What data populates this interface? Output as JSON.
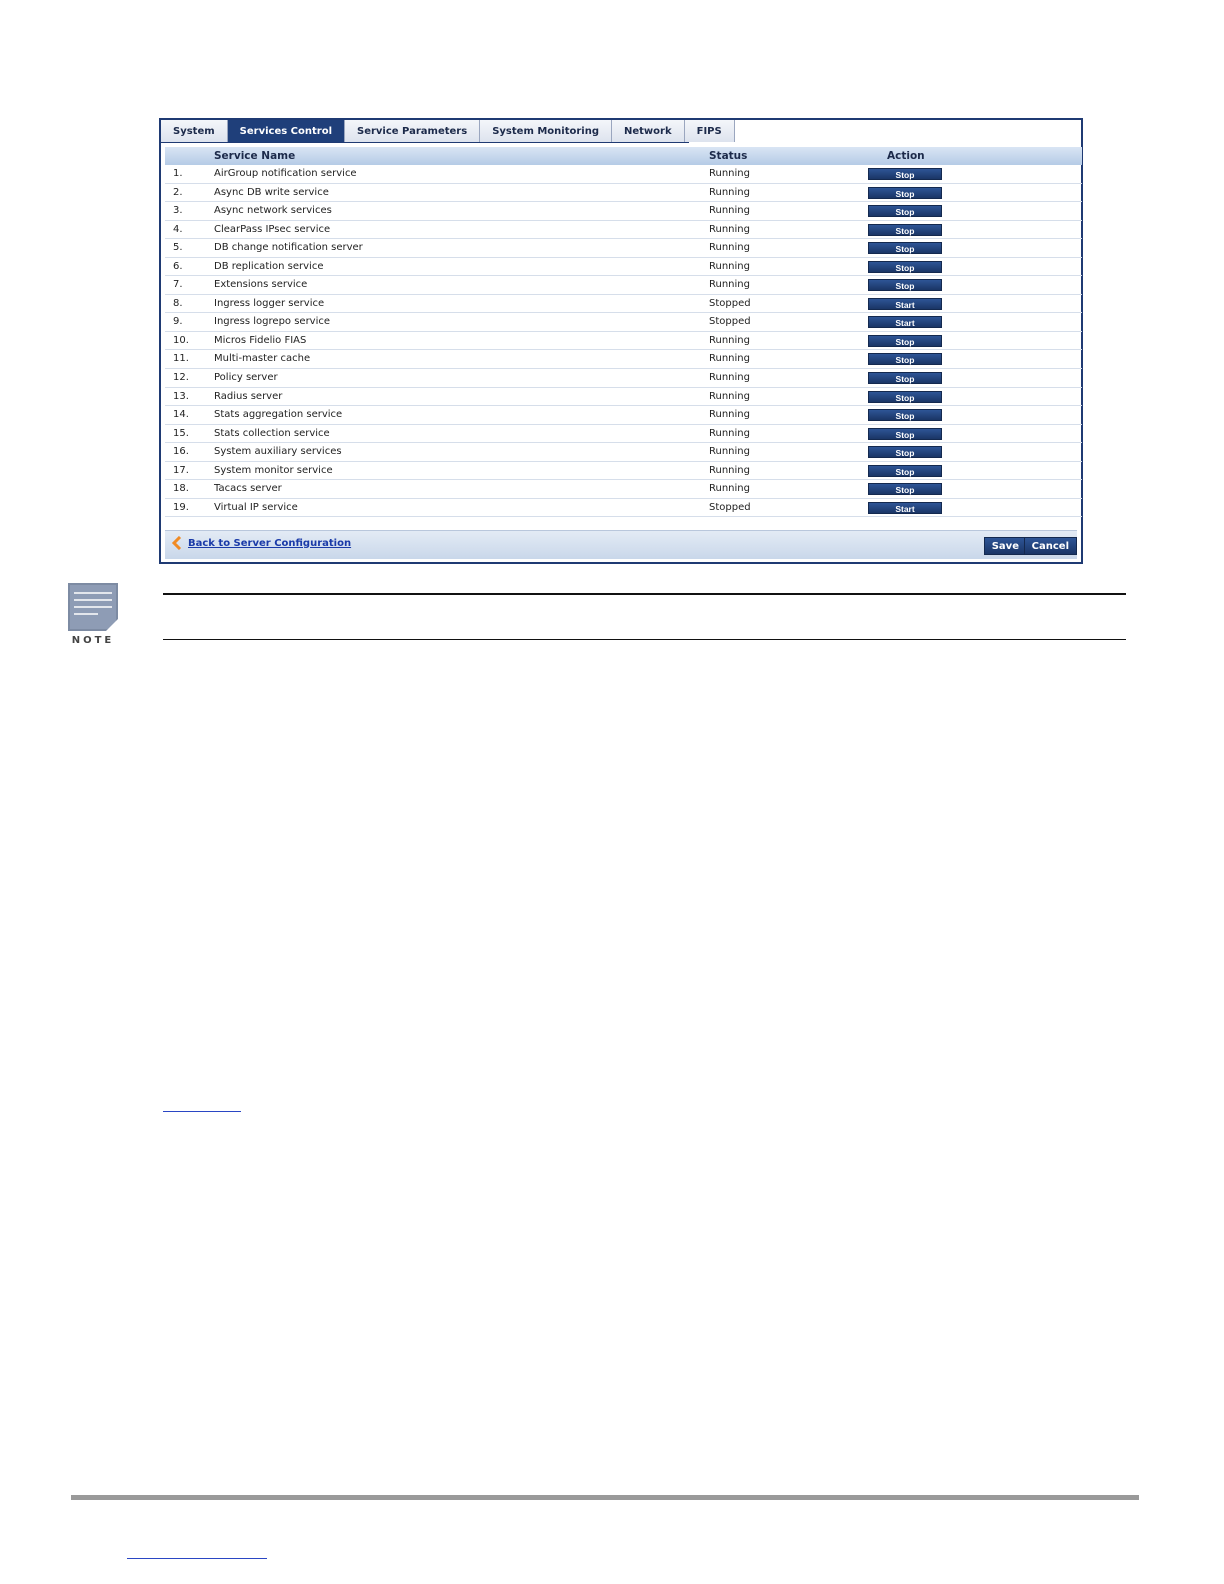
{
  "tabs": [
    "System",
    "Services Control",
    "Service Parameters",
    "System Monitoring",
    "Network",
    "FIPS"
  ],
  "active_tab": 1,
  "table": {
    "headers": {
      "name": "Service Name",
      "status": "Status",
      "action": "Action"
    },
    "rows": [
      {
        "num": "1.",
        "name": "AirGroup notification service",
        "status": "Running",
        "action": "Stop"
      },
      {
        "num": "2.",
        "name": "Async DB write service",
        "status": "Running",
        "action": "Stop"
      },
      {
        "num": "3.",
        "name": "Async network services",
        "status": "Running",
        "action": "Stop"
      },
      {
        "num": "4.",
        "name": "ClearPass IPsec service",
        "status": "Running",
        "action": "Stop"
      },
      {
        "num": "5.",
        "name": "DB change notification server",
        "status": "Running",
        "action": "Stop"
      },
      {
        "num": "6.",
        "name": "DB replication service",
        "status": "Running",
        "action": "Stop"
      },
      {
        "num": "7.",
        "name": "Extensions service",
        "status": "Running",
        "action": "Stop"
      },
      {
        "num": "8.",
        "name": "Ingress logger service",
        "status": "Stopped",
        "action": "Start"
      },
      {
        "num": "9.",
        "name": "Ingress logrepo service",
        "status": "Stopped",
        "action": "Start"
      },
      {
        "num": "10.",
        "name": "Micros Fidelio FIAS",
        "status": "Running",
        "action": "Stop"
      },
      {
        "num": "11.",
        "name": "Multi-master cache",
        "status": "Running",
        "action": "Stop"
      },
      {
        "num": "12.",
        "name": "Policy server",
        "status": "Running",
        "action": "Stop"
      },
      {
        "num": "13.",
        "name": "Radius server",
        "status": "Running",
        "action": "Stop"
      },
      {
        "num": "14.",
        "name": "Stats aggregation service",
        "status": "Running",
        "action": "Stop"
      },
      {
        "num": "15.",
        "name": "Stats collection service",
        "status": "Running",
        "action": "Stop"
      },
      {
        "num": "16.",
        "name": "System auxiliary services",
        "status": "Running",
        "action": "Stop"
      },
      {
        "num": "17.",
        "name": "System monitor service",
        "status": "Running",
        "action": "Stop"
      },
      {
        "num": "18.",
        "name": "Tacacs server",
        "status": "Running",
        "action": "Stop"
      },
      {
        "num": "19.",
        "name": "Virtual IP service",
        "status": "Stopped",
        "action": "Start"
      }
    ]
  },
  "footer": {
    "back_link": "Back to Server Configuration",
    "save_label": "Save",
    "cancel_label": "Cancel"
  },
  "note": {
    "label": "NOTE"
  },
  "colors": {
    "accent": "#1f3f7a",
    "link": "#1a3aa8",
    "arrow": "#f08a24"
  }
}
